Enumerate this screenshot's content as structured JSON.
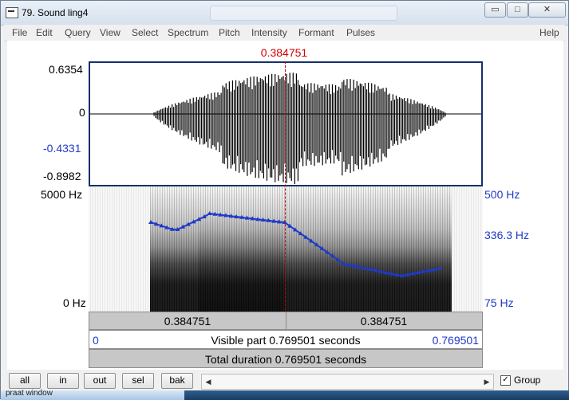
{
  "window": {
    "title": "79. Sound ling4",
    "controls": {
      "minimize": "▭",
      "maximize": "□",
      "close": "✕"
    }
  },
  "menu": {
    "items": [
      "File",
      "Edit",
      "Query",
      "View",
      "Select",
      "Spectrum",
      "Pitch",
      "Intensity",
      "Formant",
      "Pulses"
    ],
    "help": "Help"
  },
  "plot": {
    "cursor_time": "0.384751",
    "waveform_axis": {
      "max": "0.6354",
      "zero": "0",
      "blue": "-0.4331",
      "min": "-0.8982"
    },
    "spectrogram_axis_left": {
      "top": "5000 Hz",
      "bottom": "0 Hz"
    },
    "spectrogram_axis_right": {
      "top": "500 Hz",
      "mid": "336.3 Hz",
      "bottom": "75 Hz"
    },
    "time_row_1": {
      "left": "0.384751",
      "right": "0.384751"
    },
    "time_row_2": {
      "left": "0",
      "center": "Visible part 0.769501 seconds",
      "right": "0.769501"
    },
    "time_row_3": {
      "center": "Total duration 0.769501 seconds"
    }
  },
  "toolbar": {
    "buttons": [
      "all",
      "in",
      "out",
      "sel",
      "bak"
    ],
    "group_label": "Group",
    "group_checked": "✓"
  },
  "taskbar": {
    "item": "praat window"
  }
}
